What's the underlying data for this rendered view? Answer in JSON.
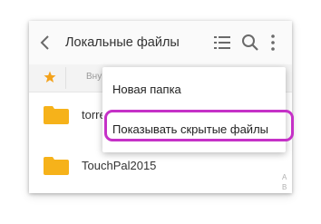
{
  "header": {
    "title": "Локальные файлы",
    "back_icon": "arrow-back-icon",
    "list_view_icon": "list-view-icon",
    "search_icon": "search-icon",
    "more_icon": "more-vert-icon"
  },
  "breadcrumb": {
    "favorite_icon": "star-icon",
    "path_text": "Вну"
  },
  "files": [
    {
      "name": "torre",
      "icon": "folder-icon"
    },
    {
      "name": "TouchPal2015",
      "icon": "folder-icon"
    }
  ],
  "side_index": [
    "A",
    "B"
  ],
  "menu": {
    "items": [
      {
        "label": "Новая папка"
      },
      {
        "label": "Показывать скрытые файлы"
      }
    ]
  },
  "colors": {
    "folder": "#f6b21a",
    "star": "#f3a21b",
    "highlight": "#c531c7",
    "toolbar_bg": "#fafafa",
    "icon": "#6a6a6a"
  }
}
